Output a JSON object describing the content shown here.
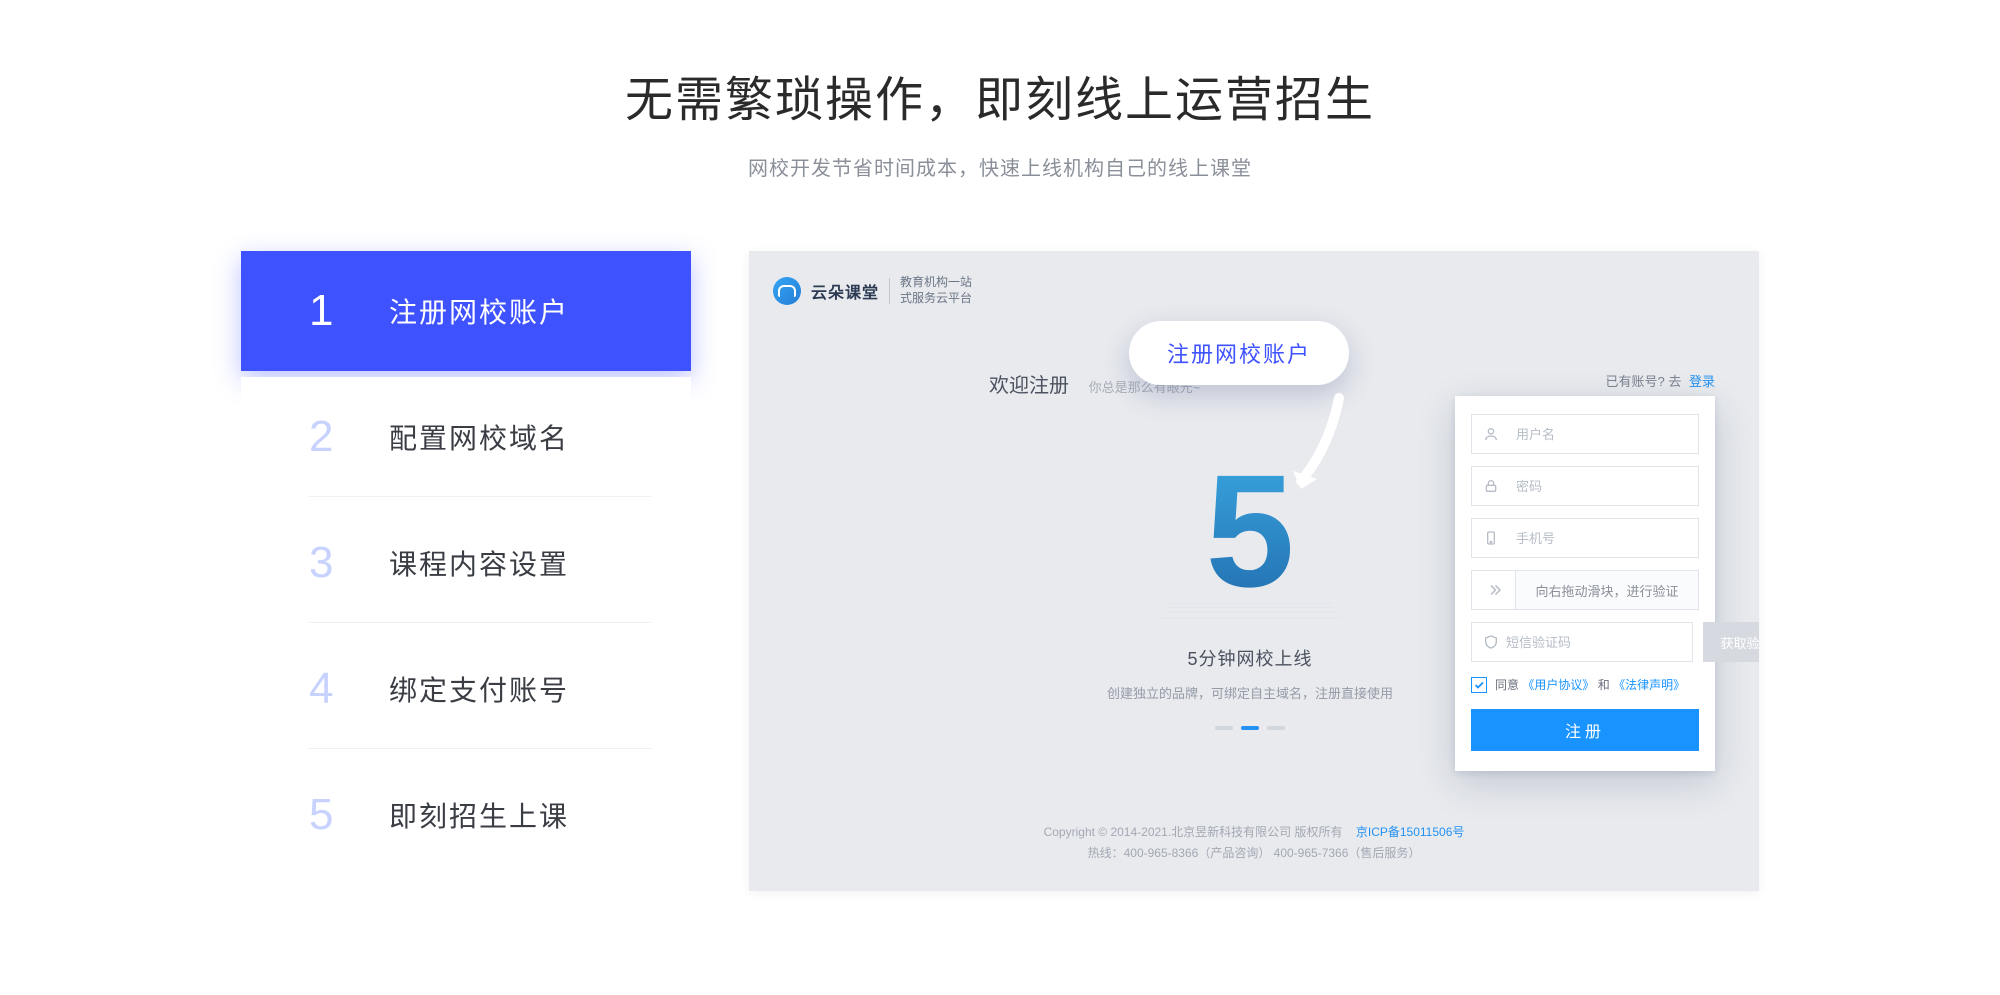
{
  "header": {
    "title": "无需繁琐操作，即刻线上运营招生",
    "subtitle": "网校开发节省时间成本，快速上线机构自己的线上课堂"
  },
  "steps": [
    {
      "num": "1",
      "label": "注册网校账户",
      "active": true
    },
    {
      "num": "2",
      "label": "配置网校域名",
      "active": false
    },
    {
      "num": "3",
      "label": "课程内容设置",
      "active": false
    },
    {
      "num": "4",
      "label": "绑定支付账号",
      "active": false
    },
    {
      "num": "5",
      "label": "即刻招生上课",
      "active": false
    }
  ],
  "callout": {
    "text": "注册网校账户"
  },
  "preview": {
    "logo": {
      "name": "云朵课堂",
      "sub1": "教育机构一站",
      "sub2": "式服务云平台"
    },
    "welcome": {
      "title": "欢迎注册",
      "sub": "你总是那么有眼光~"
    },
    "have_account": {
      "text": "已有账号? 去",
      "login": "登录"
    },
    "illustration": {
      "big": "5",
      "title": "5分钟网校上线",
      "sub": "创建独立的品牌，可绑定自主域名，注册直接使用"
    },
    "copyright": {
      "line1_a": "Copyright © 2014-2021.北京昱新科技有限公司 版权所有",
      "line1_icp": "京ICP备15011506号",
      "line2": "热线：400-965-8366（产品咨询）  400-965-7366（售后服务）"
    }
  },
  "form": {
    "username_ph": "用户名",
    "password_ph": "密码",
    "phone_ph": "手机号",
    "slider_text": "向右拖动滑块，进行验证",
    "code_ph": "短信验证码",
    "code_btn": "获取验证码",
    "agree_prefix": "同意",
    "agree_proto": "《用户协议》",
    "agree_and": "和",
    "agree_law": "《法律声明》",
    "submit": "注册"
  }
}
